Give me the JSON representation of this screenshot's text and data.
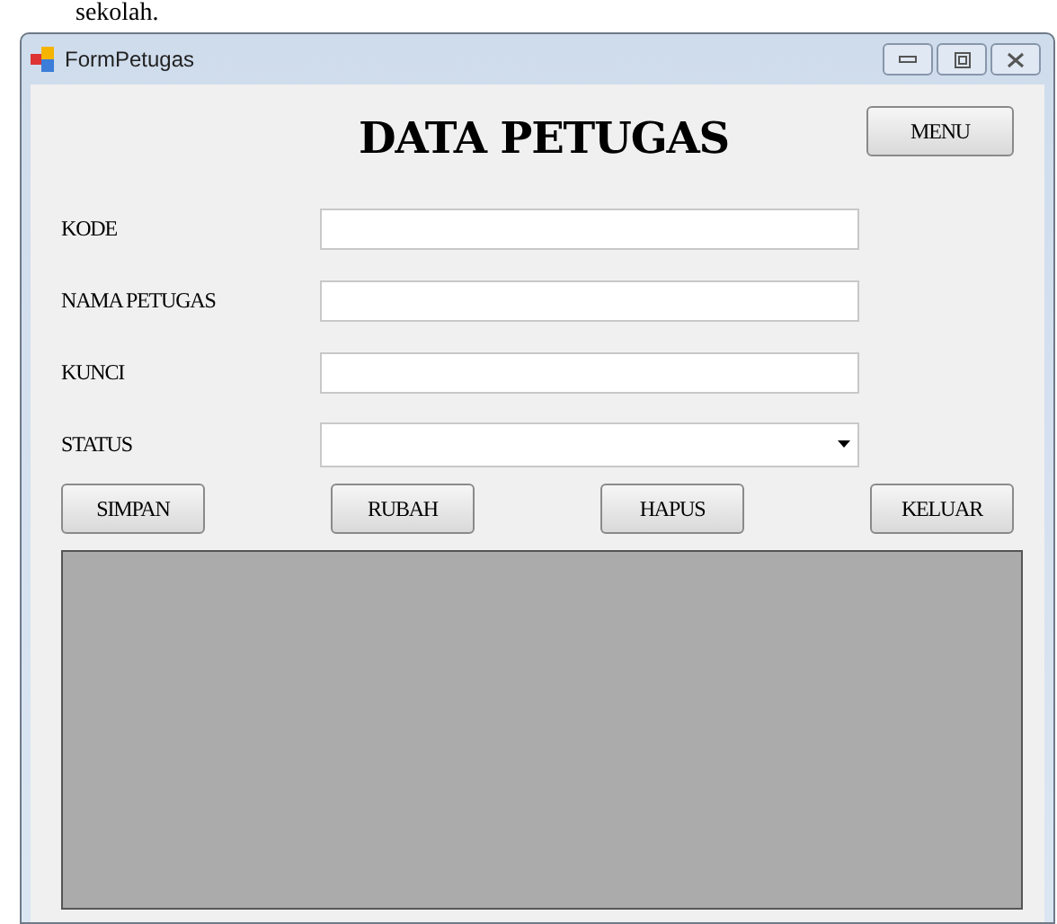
{
  "page_text": "sekolah.",
  "window": {
    "title": "FormPetugas"
  },
  "heading": "DATA PETUGAS",
  "menu_button": "MENU",
  "fields": [
    {
      "label": "KODE",
      "kind": "text"
    },
    {
      "label": "NAMA PETUGAS",
      "kind": "text"
    },
    {
      "label": "KUNCI",
      "kind": "text"
    },
    {
      "label": "STATUS",
      "kind": "combo"
    }
  ],
  "buttons": [
    "SIMPAN",
    "RUBAH",
    "HAPUS",
    "KELUAR"
  ]
}
